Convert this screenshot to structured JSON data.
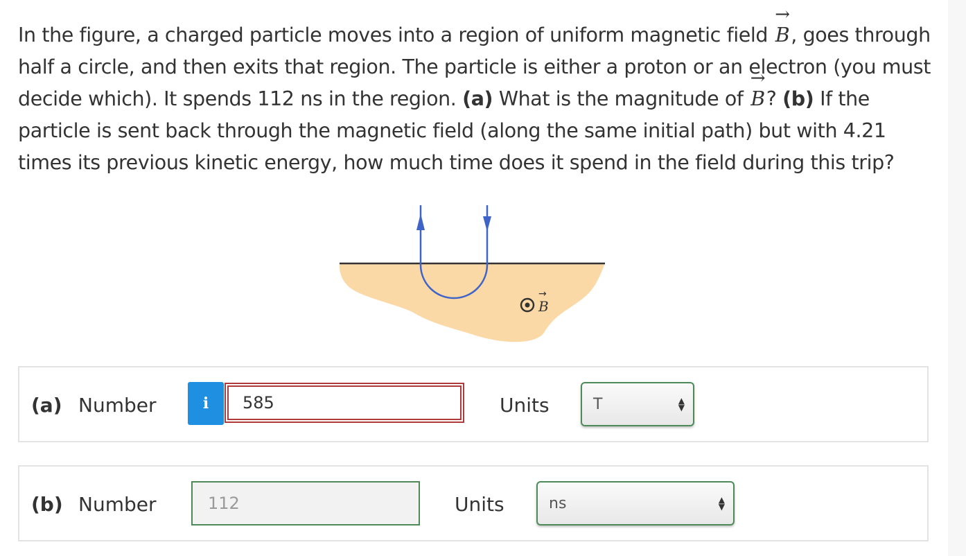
{
  "question": {
    "part1": "In the figure, a charged particle moves into a region of uniform magnetic field ",
    "vec_symbol": "B",
    "part2": ", goes through half a circle, and then exits that region. The particle is either a proton or an electron (you must decide which). It spends 112 ns in the region. ",
    "label_a": "(a)",
    "part3": " What is the magnitude of ",
    "part4": "? ",
    "label_b": "(b)",
    "part5": " If the particle is sent back through the magnetic field (along the same initial path) but with 4.21 times its previous kinetic energy, how much time does it spend in the field during this trip?"
  },
  "figure": {
    "field_label": "B",
    "colors": {
      "region": "#fbd9a6",
      "path": "#3f64c7",
      "line": "#333333"
    }
  },
  "answer_a": {
    "part_label": "(a)",
    "number_label": "Number",
    "info_icon": "i",
    "value": "585",
    "units_label": "Units",
    "unit_value": "T"
  },
  "answer_b": {
    "part_label": "(b)",
    "number_label": "Number",
    "value": "112",
    "units_label": "Units",
    "unit_value": "ns"
  },
  "colors": {
    "info_button": "#1e8fe1",
    "input_error_border": "#b03a3a",
    "field_border": "#4e8a57"
  }
}
